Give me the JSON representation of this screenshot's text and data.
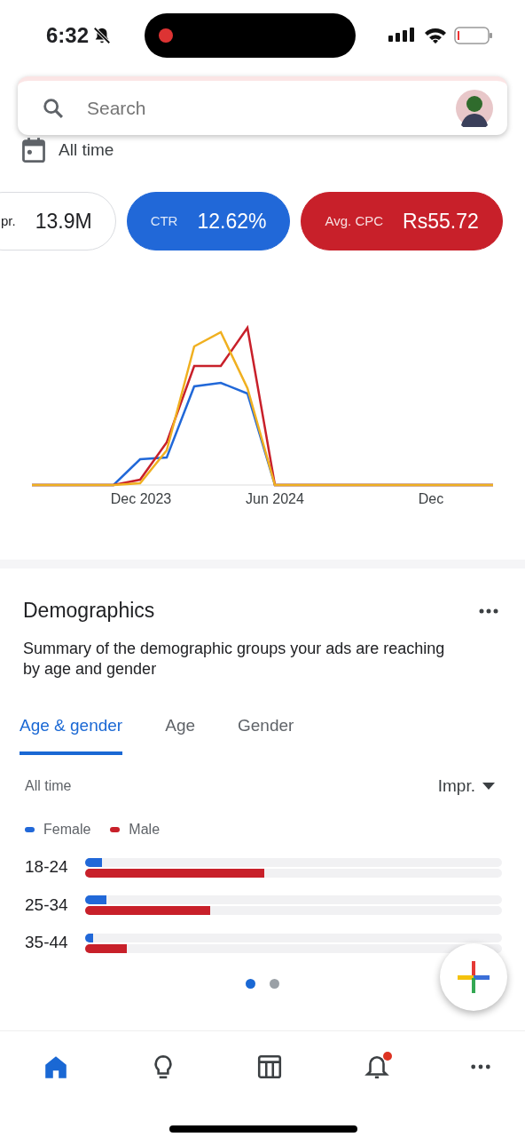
{
  "status_bar": {
    "time": "6:32",
    "silent": true,
    "recording": true
  },
  "search": {
    "placeholder": "Search"
  },
  "date_range": {
    "label": "All time"
  },
  "metrics": [
    {
      "label": "pr.",
      "value": "13.9M",
      "selected": false,
      "color": "#ffffff"
    },
    {
      "label": "CTR",
      "value": "12.62%",
      "selected": true,
      "color": "#2168d8"
    },
    {
      "label": "Avg. CPC",
      "value": "Rs55.72",
      "selected": true,
      "color": "#c8202a"
    }
  ],
  "trend_chart": {
    "x_labels": [
      "Dec 2023",
      "Jun 2024",
      "Dec"
    ]
  },
  "demographics": {
    "title": "Demographics",
    "description": "Summary of the demographic groups your ads are reaching by age and gender",
    "tabs": [
      {
        "label": "Age & gender",
        "selected": true
      },
      {
        "label": "Age",
        "selected": false
      },
      {
        "label": "Gender",
        "selected": false
      }
    ],
    "period": "All time",
    "metric_dropdown": "Impr.",
    "legend": [
      {
        "label": "Female",
        "color": "#2168d8"
      },
      {
        "label": "Male",
        "color": "#c8202a"
      }
    ],
    "groups": [
      {
        "label": "18-24",
        "female": {
          "level": 0.04
        },
        "male": {
          "level": 0.43
        }
      },
      {
        "label": "25-34",
        "female": {
          "level": 0.05
        },
        "male": {
          "level": 0.3
        }
      },
      {
        "label": "35-44",
        "female": {
          "level": 0.02
        },
        "male": {
          "level": 0.1
        }
      }
    ],
    "pages": [
      {
        "selected": true
      },
      {
        "selected": false
      }
    ]
  },
  "bottom_nav": [
    {
      "kind": "home",
      "selected": true,
      "badge": false
    },
    {
      "kind": "ideas",
      "selected": false,
      "badge": false
    },
    {
      "kind": "table",
      "selected": false,
      "badge": false
    },
    {
      "kind": "notifications",
      "selected": false,
      "badge": true
    },
    {
      "kind": "more",
      "selected": false,
      "badge": false
    }
  ]
}
